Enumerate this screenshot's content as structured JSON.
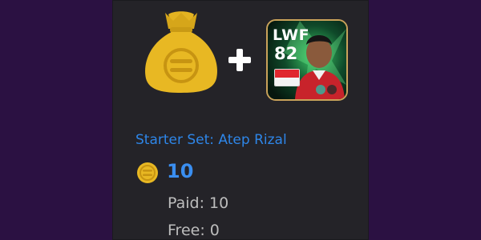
{
  "offer": {
    "title": "Starter Set: Atep Rizal",
    "price_amount": "10",
    "paid_text": "Paid: 10",
    "free_text": "Free: 0"
  },
  "player_card": {
    "position": "LWF",
    "rating": "82",
    "nation_flag": "indonesia-flag-icon"
  },
  "icons": {
    "bag": "coin-bag-icon",
    "plus": "plus-icon",
    "coin": "efootball-coin-icon"
  },
  "colors": {
    "background": "#2b1142",
    "card": "#242328",
    "accent_blue": "#2e86e8",
    "gold": "#e3b321"
  }
}
